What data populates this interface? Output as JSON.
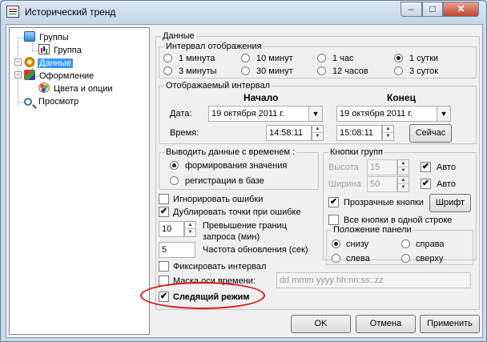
{
  "window": {
    "title": "Исторический тренд",
    "min_glyph": "–",
    "max_glyph": "□",
    "close_glyph": "✕"
  },
  "tree": [
    {
      "label": "Группы",
      "icon": "folder-icon"
    },
    {
      "label": "Группа",
      "icon": "chart-icon"
    },
    {
      "label": "Данные",
      "icon": "gear-icon",
      "selected": true
    },
    {
      "label": "Оформление",
      "icon": "design-icon"
    },
    {
      "label": "Цвета и опции",
      "icon": "palette-icon"
    },
    {
      "label": "Просмотр",
      "icon": "magnifier-icon"
    }
  ],
  "tree_expander": "−",
  "data_group": {
    "title": "Данные",
    "interval_group": {
      "title": "Интервал отображения",
      "options": [
        "1 минута",
        "10 минут",
        "1 час",
        "1 сутки",
        "3 минуты",
        "30 минут",
        "12 часов",
        "3 суток"
      ],
      "selected": "1 сутки"
    },
    "range_group": {
      "title": "Отображаемый интервал",
      "start_header": "Начало",
      "end_header": "Конец",
      "date_label": "Дата:",
      "time_label": "Время:",
      "start_date": "19  октября  2011 г.",
      "end_date": "19  октября  2011 г.",
      "start_time": "14:58:11",
      "end_time": "15:08:11",
      "now_button": "Сейчас"
    },
    "timestamp_group": {
      "title": "Выводить данные с временем :",
      "options": [
        "формирования значения",
        "регистрации в базе"
      ],
      "selected": "формирования значения"
    },
    "buttons_group": {
      "title": "Кнопки групп",
      "height_label": "Высота",
      "height_value": "15",
      "width_label": "Ширина",
      "width_value": "50",
      "auto_label": "Авто",
      "auto_height_checked": true,
      "auto_width_checked": true,
      "transparent_label": "Прозрачные кнопки",
      "transparent_checked": true,
      "font_button": "Шрифт",
      "single_row_label": "Все кнопки в одной строке",
      "single_row_checked": false
    },
    "panel_position_group": {
      "title": "Положение панели",
      "options": [
        "снизу",
        "справа",
        "слева",
        "сверху"
      ],
      "selected": "снизу"
    },
    "ignore_errors": {
      "label": "Игнорировать ошибки",
      "checked": false
    },
    "duplicate_points": {
      "label": "Дублировать точки при ошибке",
      "checked": true
    },
    "bounds_excess": {
      "value": "10",
      "label": "Превышение границ\nзапроса (мин)"
    },
    "refresh_rate": {
      "value": "5",
      "label": "Частота обновления (сек)"
    },
    "fix_interval": {
      "label": "Фиксировать интервал",
      "checked": false
    },
    "time_mask": {
      "label": "Маска оси времени:",
      "checked": false,
      "placeholder": "dd mmm yyyy hh:nn:ss::zz"
    },
    "follow_mode": {
      "label": "Следящий режим",
      "checked": true
    }
  },
  "footer": {
    "ok": "OK",
    "cancel": "Отмена",
    "apply": "Применить"
  },
  "glyphs": {
    "check": "✔",
    "dropdown": "▼",
    "spin_up": "▲",
    "spin_down": "▼"
  },
  "colors": {
    "selection": "#3399ff",
    "annotation": "#e01010"
  }
}
